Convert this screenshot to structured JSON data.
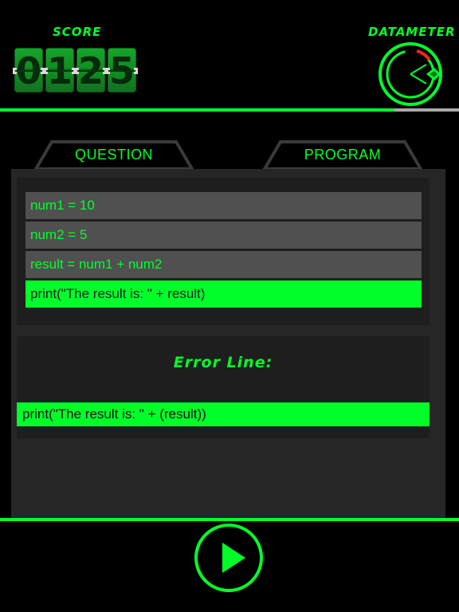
{
  "header": {
    "score_label": "SCORE",
    "score_digits": [
      "0",
      "1",
      "2",
      "5"
    ],
    "datameter_label": "DATAMETER",
    "progress_fraction": 0.86
  },
  "tabs": [
    {
      "label": "QUESTION"
    },
    {
      "label": "PROGRAM"
    }
  ],
  "program": {
    "lines": [
      {
        "text": "num1 = 10",
        "highlighted": false
      },
      {
        "text": "num2 = 5",
        "highlighted": false
      },
      {
        "text": "result = num1 + num2",
        "highlighted": false
      },
      {
        "text": "print(\"The result is: \" + result)",
        "highlighted": true
      }
    ]
  },
  "error": {
    "title": "Error Line:",
    "line": "print(\"The result is: \" + (result))"
  },
  "colors": {
    "accent": "#00ff2a",
    "panel": "#262626",
    "code_line": "#505050",
    "gauge_warning": "#ff2020"
  },
  "icons": {
    "play": "play-icon",
    "gauge": "datameter-gauge-icon"
  }
}
